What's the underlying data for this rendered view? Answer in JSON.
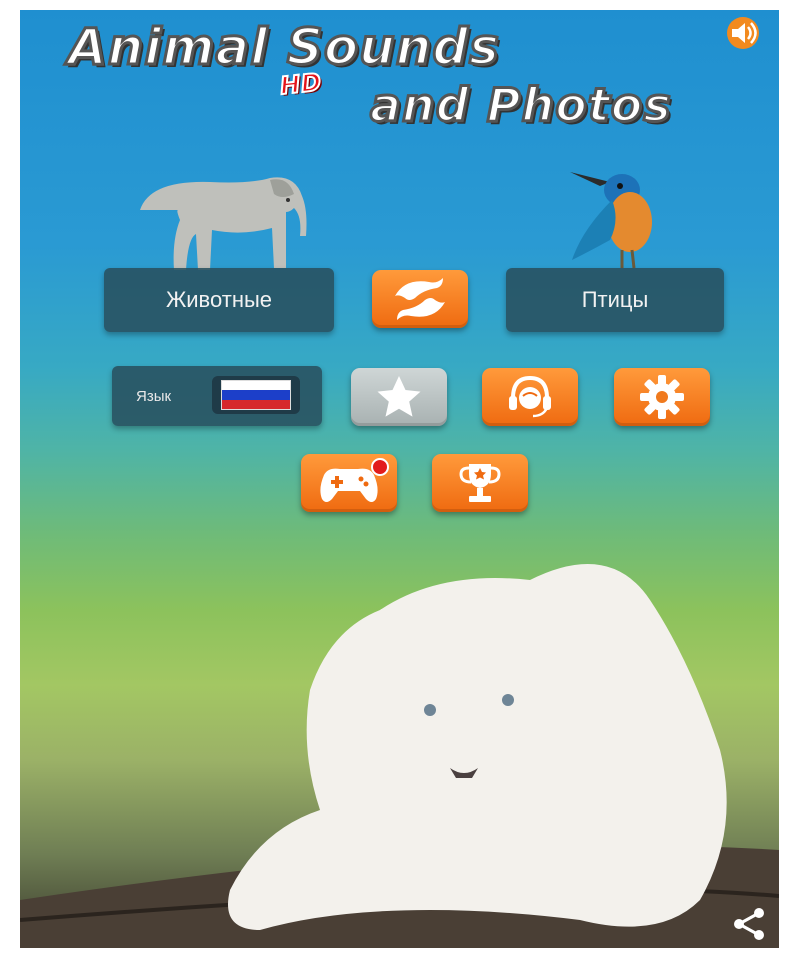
{
  "header": {
    "title_line1": "Animal Sounds",
    "title_hd": "HD",
    "title_line2": "and Photos",
    "sound_icon": "speaker-icon"
  },
  "categories": {
    "animals_label": "Животные",
    "birds_label": "Птицы",
    "swap_icon": "dolphins-swap-icon"
  },
  "settings_row": {
    "language_label": "Язык",
    "flag": "russia-flag-icon",
    "favorites_icon": "star-icon",
    "support_icon": "headset-icon",
    "settings_icon": "gear-icon"
  },
  "games_row": {
    "games_icon": "gamepad-icon",
    "achievements_icon": "trophy-icon"
  },
  "footer": {
    "share_icon": "share-icon"
  },
  "colors": {
    "accent_orange": "#f07a1e",
    "button_dark": "#2b5566",
    "flag_white": "#ffffff",
    "flag_blue": "#1c3fc9",
    "flag_red": "#d6282c"
  }
}
